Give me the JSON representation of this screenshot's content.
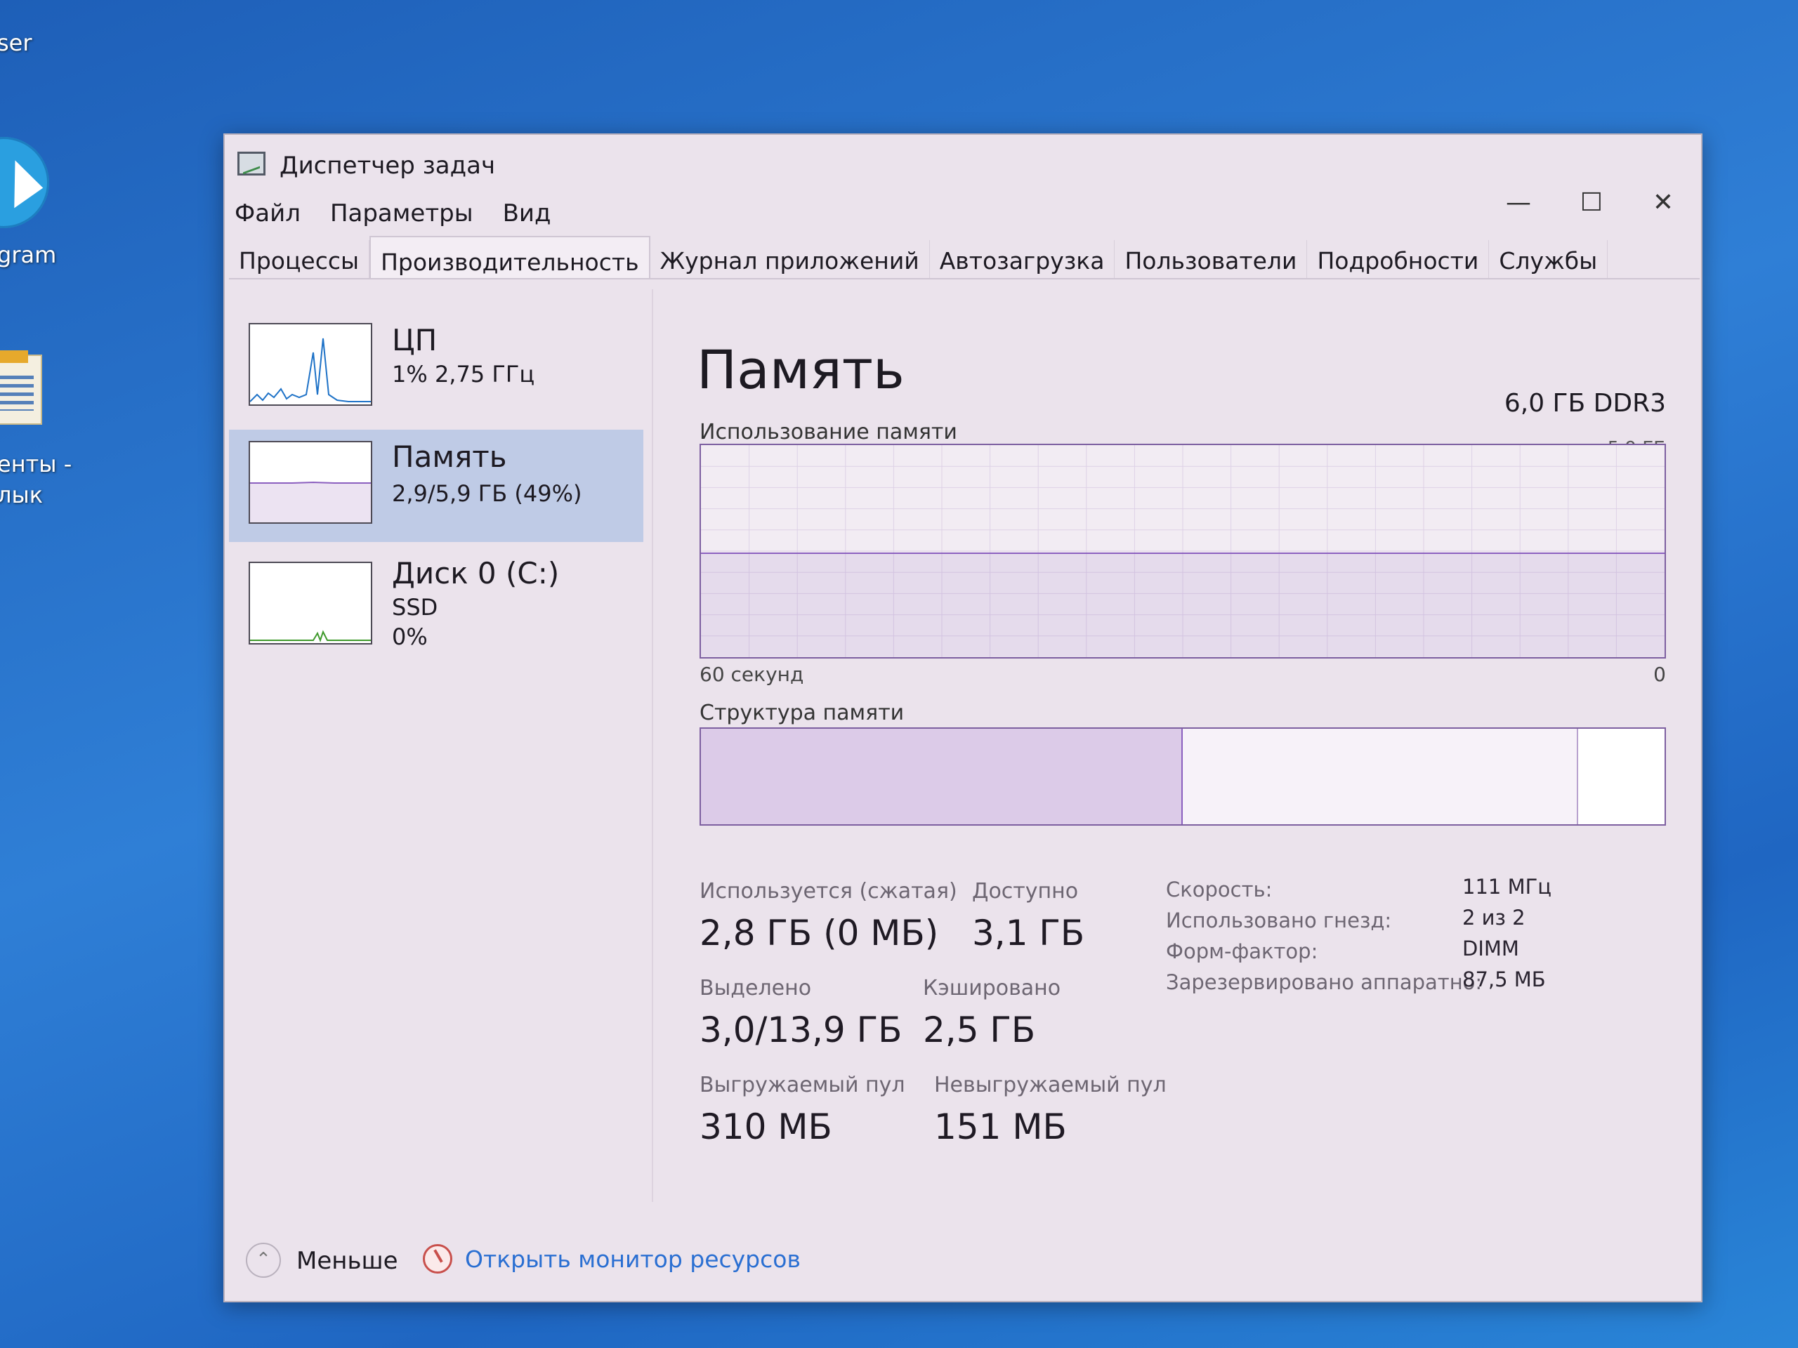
{
  "desktop": {
    "icon_labels": [
      "ser",
      "gram",
      "енты -",
      "лык"
    ]
  },
  "window": {
    "title": "Диспетчер задач",
    "controls": {
      "minimize": "—",
      "maximize": "☐",
      "close": "✕"
    },
    "menu": [
      "Файл",
      "Параметры",
      "Вид"
    ],
    "tabs": [
      "Процессы",
      "Производительность",
      "Журнал приложений",
      "Автозагрузка",
      "Пользователи",
      "Подробности",
      "Службы"
    ],
    "active_tab": "Производительность"
  },
  "sidebar": {
    "items": [
      {
        "title": "ЦП",
        "sub1": "1% 2,75 ГГц",
        "sub2": ""
      },
      {
        "title": "Память",
        "sub1": "2,9/5,9 ГБ (49%)",
        "sub2": ""
      },
      {
        "title": "Диск 0 (C:)",
        "sub1": "SSD",
        "sub2": "0%"
      }
    ],
    "selected": "Память"
  },
  "main": {
    "title": "Память",
    "type": "6,0 ГБ DDR3",
    "chart": {
      "label": "Использование памяти",
      "max_label": "5,9 ГБ",
      "left_label": "60 секунд",
      "right_label": "0",
      "usage_fraction": 0.49
    },
    "structure": {
      "label": "Структура памяти",
      "in_use_fraction": 0.5,
      "standby_fraction": 0.41,
      "free_fraction": 0.09
    },
    "stats": {
      "in_use_label": "Используется (сжатая)",
      "in_use_value": "2,8 ГБ (0 МБ)",
      "available_label": "Доступно",
      "available_value": "3,1 ГБ",
      "committed_label": "Выделено",
      "committed_value": "3,0/13,9 ГБ",
      "cached_label": "Кэшировано",
      "cached_value": "2,5 ГБ",
      "paged_label": "Выгружаемый пул",
      "paged_value": "310 МБ",
      "nonpaged_label": "Невыгружаемый пул",
      "nonpaged_value": "151 МБ"
    },
    "props": [
      {
        "label": "Скорость:",
        "value": "111 МГц"
      },
      {
        "label": "Использовано гнезд:",
        "value": "2 из 2"
      },
      {
        "label": "Форм-фактор:",
        "value": "DIMM"
      },
      {
        "label": "Зарезервировано аппаратно:",
        "value": "87,5 МБ"
      }
    ]
  },
  "footer": {
    "less_label": "Меньше",
    "resource_monitor_label": "Открыть монитор ресурсов"
  },
  "colors": {
    "memory_accent": "#8b5fbf",
    "cpu_accent": "#1e72c7",
    "disk_accent": "#3f9a2c",
    "link": "#2a6fd2"
  }
}
